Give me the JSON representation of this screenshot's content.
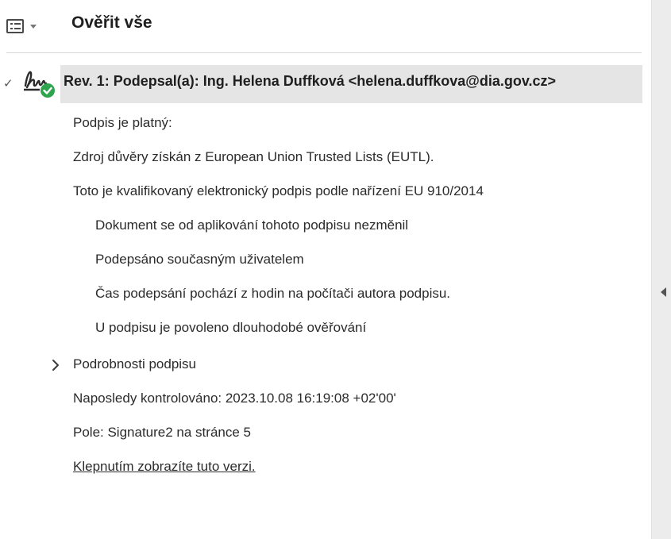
{
  "header": {
    "title": "Ověřit vše",
    "options_icon": "list-options-icon",
    "caret_icon": "chevron-down-icon"
  },
  "signature": {
    "title": "Rev. 1: Podepsal(a): Ing. Helena Duffková <helena.duffkova@dia.gov.cz>",
    "icon": "signature-valid-icon",
    "status_color": "#2ea44f",
    "details": {
      "validity": "Podpis je platný:",
      "trust_source": "Zdroj důvěry získán z European Union Trusted Lists (EUTL).",
      "qualified": "Toto je kvalifikovaný elektronický podpis podle nařízení EU 910/2014",
      "sub_items": [
        "Dokument se od aplikování tohoto podpisu nezměnil",
        "Podepsáno současným uživatelem",
        "Čas podepsání pochází z hodin na počítači autora podpisu.",
        "U podpisu je povoleno dlouhodobé ověřování"
      ],
      "signature_details": "Podrobnosti podpisu",
      "last_checked": "Naposledy kontrolováno: 2023.10.08 16:19:08 +02'00'",
      "field": "Pole: Signature2 na stránce 5",
      "view_version_link": "Klepnutím zobrazíte tuto verzi."
    }
  }
}
